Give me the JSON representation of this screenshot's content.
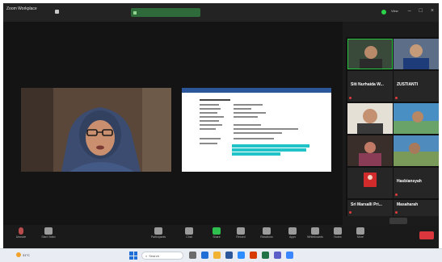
{
  "window": {
    "app_name": "Zoom Workplace",
    "title_left": "",
    "share_label": "",
    "view_label": "View"
  },
  "gallery": {
    "tiles": [
      {
        "name": "",
        "big": "",
        "active": true
      },
      {
        "name": "",
        "big": ""
      },
      {
        "name": "",
        "big": "Siti Nurhaida W..."
      },
      {
        "name": "",
        "big": "ZUSTIANTI"
      },
      {
        "name": "",
        "big": ""
      },
      {
        "name": "",
        "big": ""
      },
      {
        "name": "",
        "big": ""
      },
      {
        "name": "",
        "big": ""
      },
      {
        "name": "",
        "big": ""
      },
      {
        "name": "",
        "big": "Hasbiansyah"
      },
      {
        "name": "",
        "big": "Sri Marsalli Pri..."
      },
      {
        "name": "",
        "big": "Masaharah"
      }
    ]
  },
  "toolbar": {
    "items": [
      "Unmute",
      "Start Video",
      "Participants",
      "Chat",
      "Share",
      "Record",
      "Reactions",
      "Apps",
      "Whiteboards",
      "Notes",
      "More",
      "End"
    ]
  },
  "taskbar": {
    "weather": "31°C",
    "search_placeholder": "Search",
    "tray_time": "",
    "tray_date": ""
  },
  "colors": {
    "zoom_bg": "#1b1b1b",
    "share_green": "#2fbf4f",
    "end_red": "#d9363e",
    "doc_highlight": "#20c3c8",
    "spotlight_border": "#25c33b"
  }
}
